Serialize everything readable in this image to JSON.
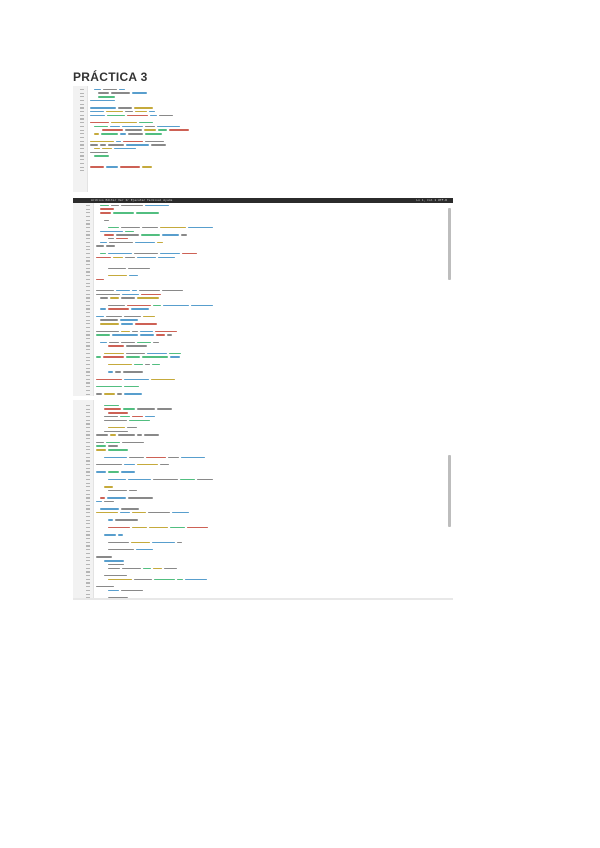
{
  "document": {
    "title": "PRÁCTICA 3"
  },
  "screenshots": [
    {
      "name": "code-screenshot-1",
      "has_menubar": false
    },
    {
      "name": "code-screenshot-2",
      "has_menubar": true,
      "menubar_left": "Archivo  Editar  Ver  Ir  Ejecutar  Terminal  Ayuda",
      "menubar_right": "Ln 1, Col 1  UTF-8"
    },
    {
      "name": "code-screenshot-3",
      "has_menubar": false
    }
  ],
  "colors": {
    "keyword": "#2e86c1",
    "function": "#b7950b",
    "string": "#27ae60",
    "comment": "#7f8c8d",
    "plain": "#6b6b6b",
    "number": "#c0392b"
  }
}
